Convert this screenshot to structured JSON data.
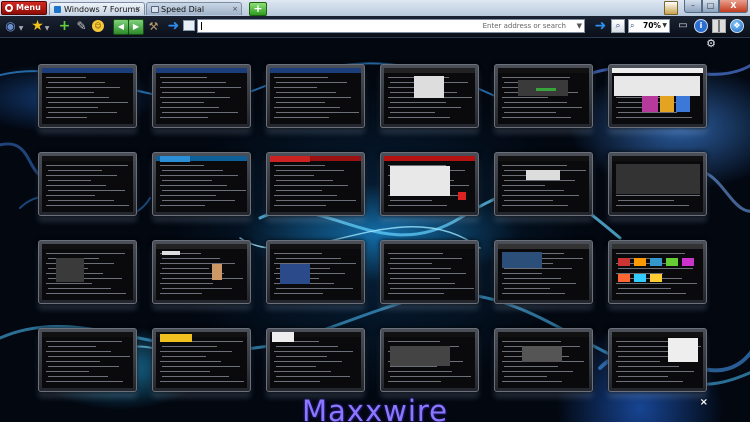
{
  "window": {
    "menu_label": "Menu",
    "tabs": [
      {
        "label": "Windows 7 Forums",
        "close": "×"
      },
      {
        "label": "Speed Dial",
        "close": "×"
      }
    ],
    "new_tab": "+",
    "controls": {
      "minimize": "–",
      "maximize": "□",
      "close": "X"
    }
  },
  "toolbar": {
    "address_value": "",
    "address_placeholder": "Enter address or search",
    "zoom_level": "70%"
  },
  "speed_dial": {
    "brand_text": "Maxxwire",
    "close_glyph": "×",
    "settings_glyph": "⚙",
    "thumbnail_count": 24
  }
}
